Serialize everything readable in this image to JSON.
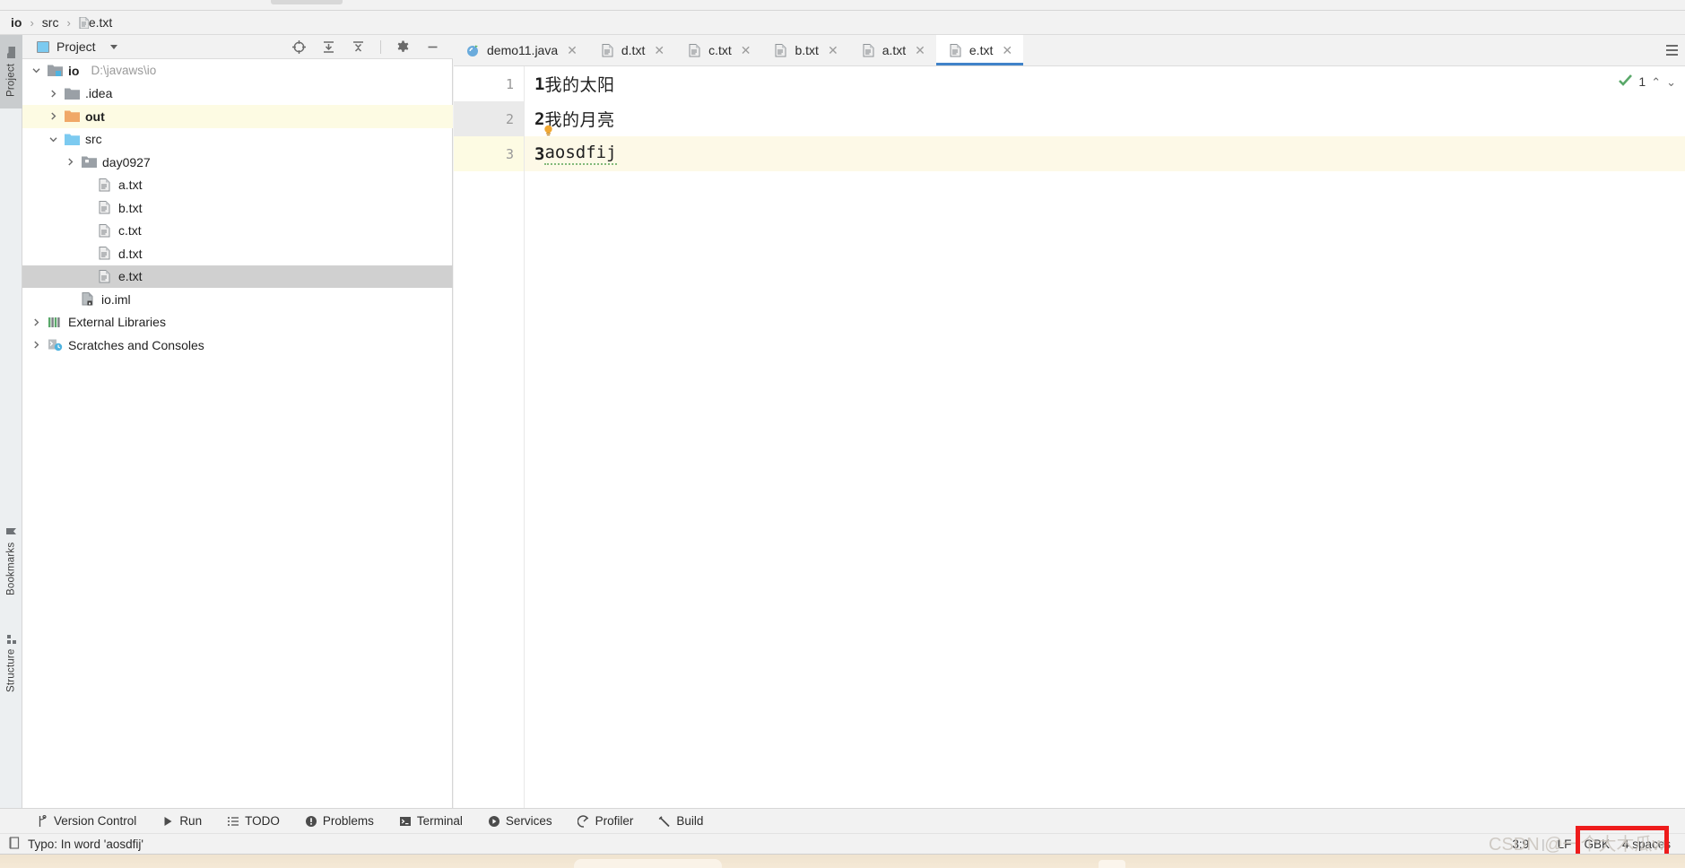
{
  "breadcrumb": {
    "root": "io",
    "sep": "›",
    "folder": "src",
    "file": "e.txt"
  },
  "left_rail": {
    "project": "Project",
    "bookmarks": "Bookmarks",
    "structure": "Structure"
  },
  "project_panel": {
    "title": "Project",
    "tools": [
      {
        "name": "locate-icon",
        "label": "Select Opened File"
      },
      {
        "name": "expand-all-icon",
        "label": "Expand All"
      },
      {
        "name": "collapse-all-icon",
        "label": "Collapse All"
      },
      {
        "name": "gear-icon",
        "label": "Options"
      },
      {
        "name": "minimize-icon",
        "label": "Hide"
      }
    ],
    "tree": [
      {
        "label": "io",
        "path": "D:\\javaws\\io",
        "icon": "module-folder",
        "twist": "down",
        "indent": 0,
        "bold": true,
        "state": "normal"
      },
      {
        "label": ".idea",
        "path": "",
        "icon": "folder-grey",
        "twist": "right",
        "indent": 1,
        "bold": false,
        "state": "normal"
      },
      {
        "label": "out",
        "path": "",
        "icon": "folder-orange",
        "twist": "right",
        "indent": 1,
        "bold": true,
        "state": "highlight"
      },
      {
        "label": "src",
        "path": "",
        "icon": "folder-blue",
        "twist": "down",
        "indent": 1,
        "bold": false,
        "state": "normal"
      },
      {
        "label": "day0927",
        "path": "",
        "icon": "package",
        "twist": "right",
        "indent": 2,
        "bold": false,
        "state": "normal"
      },
      {
        "label": "a.txt",
        "path": "",
        "icon": "text-file",
        "twist": "none",
        "indent": 3,
        "bold": false,
        "state": "normal"
      },
      {
        "label": "b.txt",
        "path": "",
        "icon": "text-file",
        "twist": "none",
        "indent": 3,
        "bold": false,
        "state": "normal"
      },
      {
        "label": "c.txt",
        "path": "",
        "icon": "text-file",
        "twist": "none",
        "indent": 3,
        "bold": false,
        "state": "normal"
      },
      {
        "label": "d.txt",
        "path": "",
        "icon": "text-file",
        "twist": "none",
        "indent": 3,
        "bold": false,
        "state": "normal"
      },
      {
        "label": "e.txt",
        "path": "",
        "icon": "text-file",
        "twist": "none",
        "indent": 3,
        "bold": false,
        "state": "selected"
      },
      {
        "label": "io.iml",
        "path": "",
        "icon": "iml-file",
        "twist": "none",
        "indent": 2,
        "bold": false,
        "state": "normal"
      },
      {
        "label": "External Libraries",
        "path": "",
        "icon": "libraries",
        "twist": "right",
        "indent": 0,
        "bold": false,
        "state": "normal"
      },
      {
        "label": "Scratches and Consoles",
        "path": "",
        "icon": "scratches",
        "twist": "right",
        "indent": 0,
        "bold": false,
        "state": "normal"
      }
    ]
  },
  "editor": {
    "tabs": [
      {
        "label": "demo11.java",
        "icon": "java-class-icon",
        "active": false
      },
      {
        "label": "d.txt",
        "icon": "text-file-icon",
        "active": false
      },
      {
        "label": "c.txt",
        "icon": "text-file-icon",
        "active": false
      },
      {
        "label": "b.txt",
        "icon": "text-file-icon",
        "active": false
      },
      {
        "label": "a.txt",
        "icon": "text-file-icon",
        "active": false
      },
      {
        "label": "e.txt",
        "icon": "text-file-icon",
        "active": true
      }
    ],
    "close_glyph": "✕",
    "lines": [
      {
        "num": "1",
        "prefix": "1",
        "text": "我的太阳",
        "cjk": true,
        "current": false,
        "typo": false,
        "bulb": false
      },
      {
        "num": "2",
        "prefix": "2",
        "text": "我的月亮",
        "cjk": true,
        "current": false,
        "typo": false,
        "bulb": true
      },
      {
        "num": "3",
        "prefix": "3",
        "text": "aosdfij",
        "cjk": false,
        "current": true,
        "typo": true,
        "bulb": false
      }
    ],
    "inspection": {
      "count": "1",
      "up_glyph": "⌃",
      "down_glyph": "⌄"
    }
  },
  "bottom_toolbar": [
    {
      "label": "Version Control",
      "icon": "branch-icon"
    },
    {
      "label": "Run",
      "icon": "play-icon"
    },
    {
      "label": "TODO",
      "icon": "list-icon"
    },
    {
      "label": "Problems",
      "icon": "warning-icon"
    },
    {
      "label": "Terminal",
      "icon": "terminal-icon"
    },
    {
      "label": "Services",
      "icon": "services-icon"
    },
    {
      "label": "Profiler",
      "icon": "profiler-icon"
    },
    {
      "label": "Build",
      "icon": "hammer-icon"
    }
  ],
  "status_bar": {
    "message": "Typo: In word 'aosdfij'",
    "caret": "3:9",
    "line_sep": "LF",
    "encoding": "GBK",
    "indent": "4 spaces",
    "divider": "|"
  },
  "watermark": "CSDN @一个大木瓜w",
  "colors": {
    "accent_blue": "#4083c9",
    "highlight_yellow": "#fdfbe3",
    "selection_grey": "#d0d0d0",
    "typo_green": "#83b97a",
    "box_red": "#ee1c1c",
    "folder_orange": "#f0a868",
    "folder_blue": "#7ccaf0"
  }
}
